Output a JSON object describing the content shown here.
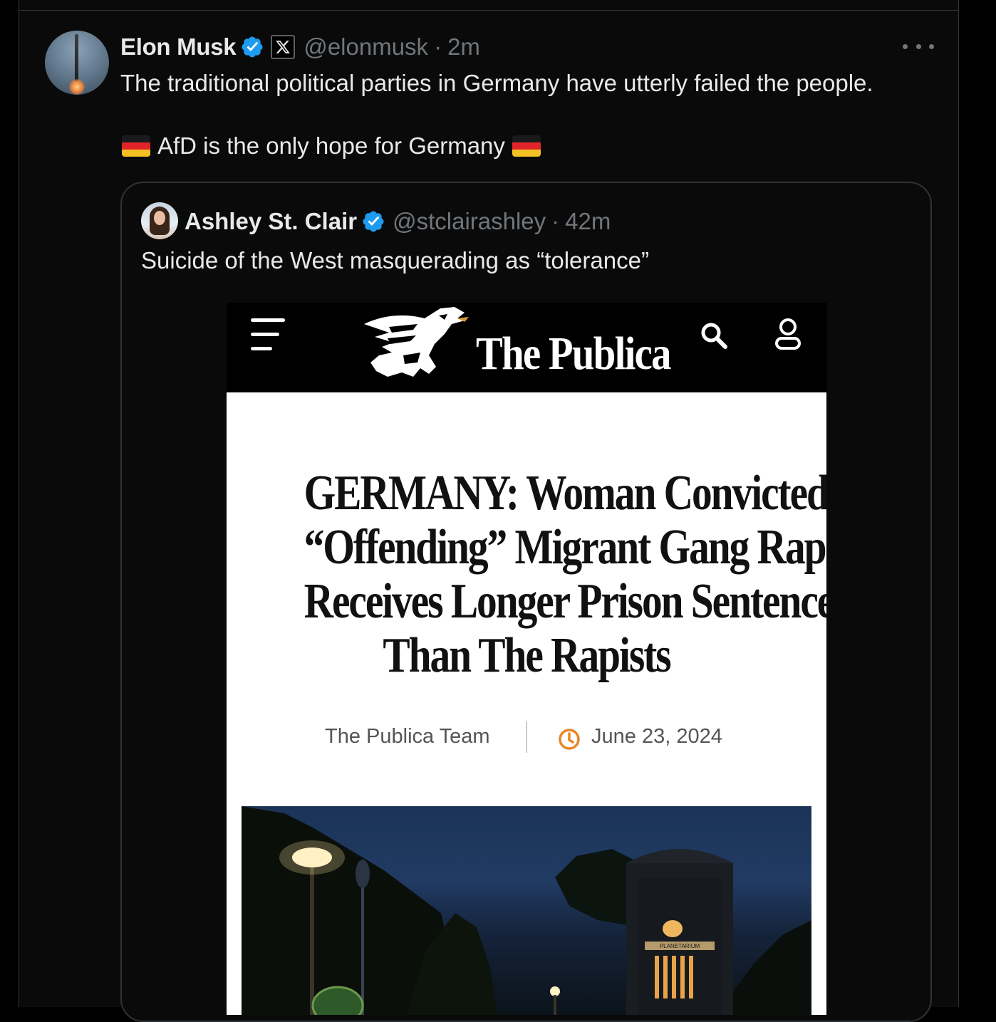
{
  "tweet": {
    "author_name": "Elon Musk",
    "handle": "@elonmusk",
    "separator": "·",
    "time": "2m",
    "text_line1": "The traditional political parties in Germany have utterly failed the people.",
    "text_line2": "AfD is the only hope for Germany"
  },
  "quoted": {
    "author_name": "Ashley St. Clair",
    "handle": "@stclairashley",
    "separator": "·",
    "time": "42m",
    "text": "Suicide of the West masquerading as “tolerance”"
  },
  "article": {
    "site_name": "The Publica",
    "headline_lines": [
      "GERMANY: Woman Convicted Of",
      "“Offending” Migrant Gang Rapists",
      "Receives Longer Prison Sentence",
      "Than The Rapists"
    ],
    "author": "The Publica Team",
    "date": "June 23, 2024",
    "photo_sign": "PLANETARIUM"
  },
  "colors": {
    "verified_blue": "#1d9bf0",
    "text_primary": "#e7e9ea",
    "text_secondary": "#71767b",
    "date_icon_orange": "#e8852a"
  },
  "icons": [
    "verified-badge-icon",
    "x-affiliate-badge-icon",
    "more-options-icon",
    "germany-flag-icon",
    "menu-icon",
    "search-icon",
    "user-icon",
    "clock-icon"
  ]
}
